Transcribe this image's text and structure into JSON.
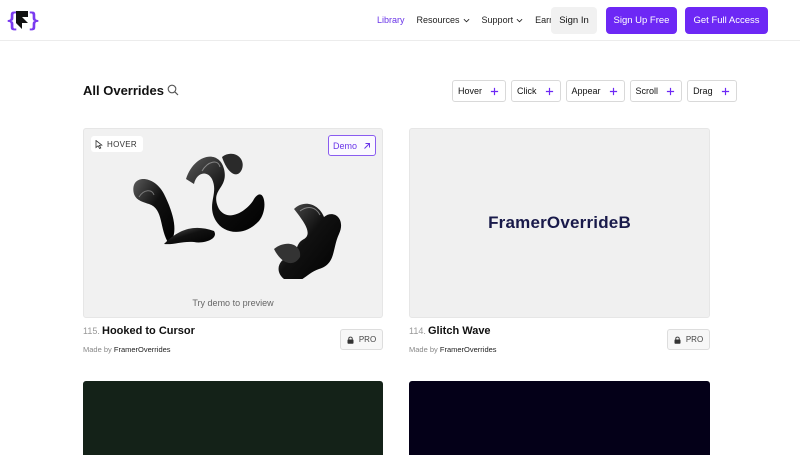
{
  "nav": {
    "links": [
      {
        "label": "Library",
        "active": true,
        "dropdown": false
      },
      {
        "label": "Resources",
        "active": false,
        "dropdown": true
      },
      {
        "label": "Support",
        "active": false,
        "dropdown": true
      },
      {
        "label": "Earn",
        "active": false,
        "dropdown": true
      }
    ],
    "signin_label": "Sign In",
    "signup_label": "Sign Up Free",
    "access_label": "Get Full Access"
  },
  "header": {
    "title": "All Overrides",
    "filters": [
      "Hover",
      "Click",
      "Appear",
      "Scroll",
      "Drag"
    ]
  },
  "cards": [
    {
      "number": "115.",
      "name": "Hooked to Cursor",
      "made_by_prefix": "Made by",
      "author": "FramerOverrides",
      "badge": "PRO",
      "tag": "HOVER",
      "demo_label": "Demo",
      "preview_hint": "Try demo to preview"
    },
    {
      "number": "114.",
      "name": "Glitch Wave",
      "made_by_prefix": "Made by",
      "author": "FramerOverrides",
      "badge": "PRO",
      "brand_text": "FramerOverrideB"
    }
  ],
  "colors": {
    "accent": "#6d28f5",
    "active_link": "#6a35e8",
    "brand_text": "#191a4a",
    "card3_bg": "#142218",
    "card4_bg": "#040018"
  },
  "icons": {
    "logo": "framer-logo-icon",
    "search": "search-icon",
    "chevron": "chevron-down-icon",
    "plus": "plus-icon",
    "cursor": "cursor-pointer-icon",
    "arrow": "arrow-up-right-icon",
    "lock": "lock-icon"
  }
}
